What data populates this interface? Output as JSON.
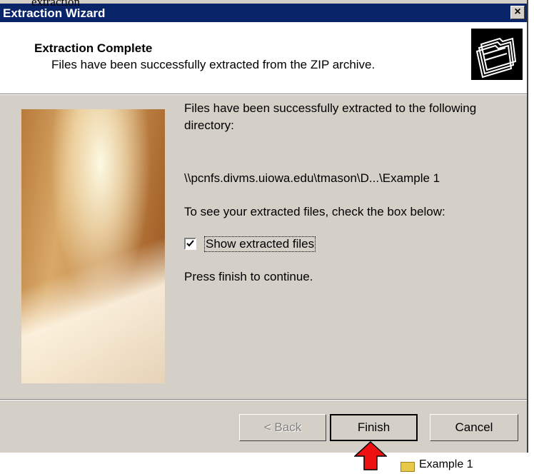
{
  "doc_caption": "extraction",
  "window": {
    "title": "Extraction Wizard",
    "close_label": "×"
  },
  "header": {
    "title": "Extraction Complete",
    "subtitle": "Files have been successfully extracted from the ZIP archive."
  },
  "content": {
    "message": "Files have been successfully extracted to the following directory:",
    "directory": "\\\\pcnfs.divms.uiowa.edu\\tmason\\D...\\Example 1",
    "instruction": "To see your extracted files, check the box below:",
    "checkbox_label": "Show extracted files",
    "checkbox_checked": true,
    "press_text": "Press finish to continue."
  },
  "buttons": {
    "back": "< Back",
    "finish": "Finish",
    "cancel": "Cancel"
  },
  "behind": {
    "folder_label": "Example 1"
  },
  "colors": {
    "titlebar": "#0a246a",
    "dialog_face": "#d4d0c8",
    "arrow": "#ee1111"
  }
}
